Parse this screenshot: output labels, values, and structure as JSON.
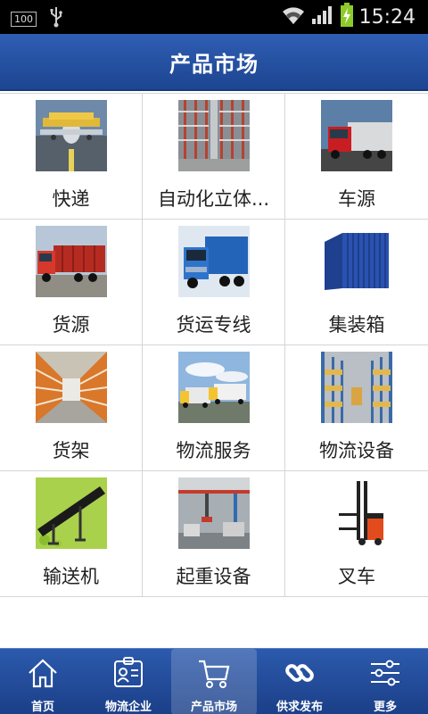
{
  "status_bar": {
    "battery_badge": "100",
    "time": "15:24"
  },
  "header": {
    "title": "产品市场"
  },
  "grid": {
    "items": [
      {
        "label": "快递",
        "icon": "cargo-plane-image"
      },
      {
        "label": "自动化立体...",
        "icon": "warehouse-racks-image"
      },
      {
        "label": "车源",
        "icon": "red-truck-image"
      },
      {
        "label": "货源",
        "icon": "cargo-truck-image"
      },
      {
        "label": "货运专线",
        "icon": "blue-truck-image"
      },
      {
        "label": "集装箱",
        "icon": "container-image"
      },
      {
        "label": "货架",
        "icon": "shelving-image"
      },
      {
        "label": "物流服务",
        "icon": "truck-fleet-image"
      },
      {
        "label": "物流设备",
        "icon": "warehouse-equipment-image"
      },
      {
        "label": "输送机",
        "icon": "conveyor-image"
      },
      {
        "label": "起重设备",
        "icon": "crane-image"
      },
      {
        "label": "叉车",
        "icon": "forklift-image"
      }
    ]
  },
  "bottom_nav": {
    "items": [
      {
        "label": "首页",
        "icon": "home-icon"
      },
      {
        "label": "物流企业",
        "icon": "id-card-icon"
      },
      {
        "label": "产品市场",
        "icon": "cart-icon",
        "active": true
      },
      {
        "label": "供求发布",
        "icon": "link-icon"
      },
      {
        "label": "更多",
        "icon": "sliders-icon"
      }
    ]
  },
  "colors": {
    "header_blue": "#1d4591",
    "nav_blue": "#2c5aad"
  }
}
